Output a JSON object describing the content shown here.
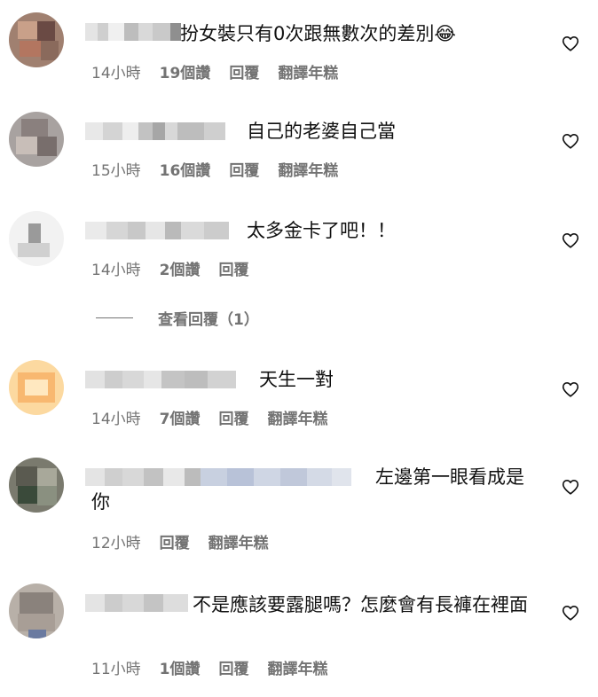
{
  "comments": [
    {
      "text": "扮女裝只有0次跟無數次的差別😂",
      "time": "14小時",
      "likes": "19個讚",
      "reply": "回覆",
      "translate": "翻譯年糕"
    },
    {
      "text": "自己的老婆自己當",
      "time": "15小時",
      "likes": "16個讚",
      "reply": "回覆",
      "translate": "翻譯年糕"
    },
    {
      "text": "太多金卡了吧！！",
      "time": "14小時",
      "likes": "2個讚",
      "reply": "回覆"
    },
    {
      "text": "天生一對",
      "time": "14小時",
      "likes": "7個讚",
      "reply": "回覆",
      "translate": "翻譯年糕"
    },
    {
      "text": "左邊第一眼看成是你",
      "time": "12小時",
      "reply": "回覆",
      "translate": "翻譯年糕"
    },
    {
      "text": "不是應該要露腿嗎？怎麼會有長褲在裡面",
      "time": "11小時",
      "likes": "1個讚",
      "reply": "回覆",
      "translate": "翻譯年糕"
    }
  ],
  "view_replies": "查看回覆（1）",
  "icons": {
    "like": "heart-outline-icon"
  },
  "colors": {
    "meta": "#737373",
    "text": "#111111"
  }
}
